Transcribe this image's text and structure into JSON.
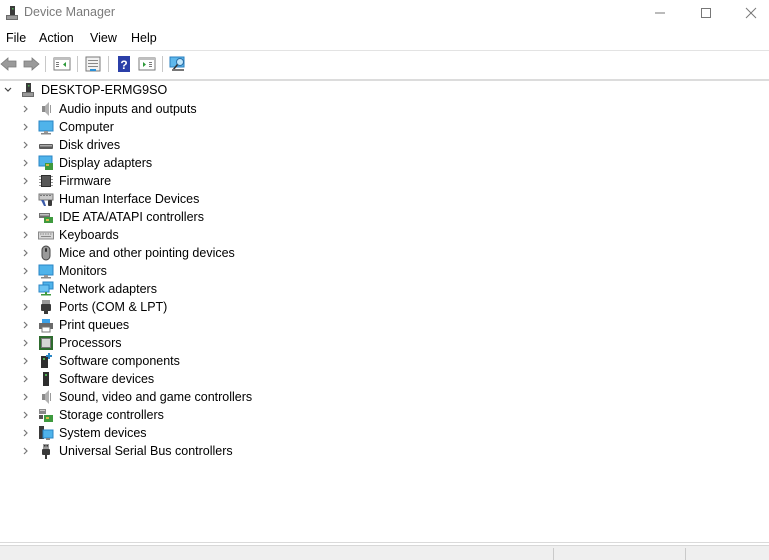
{
  "window": {
    "title": "Device Manager",
    "app_icon": "device-manager-icon",
    "controls": {
      "minimize": "—",
      "maximize": "☐",
      "close": "✕"
    }
  },
  "menubar": {
    "items": [
      {
        "label": "File"
      },
      {
        "label": "Action"
      },
      {
        "label": "View"
      },
      {
        "label": "Help"
      }
    ]
  },
  "toolbar": {
    "buttons": [
      {
        "name": "back",
        "icon": "back-arrow-icon"
      },
      {
        "name": "forward",
        "icon": "forward-arrow-icon"
      },
      {
        "name": "show-hide-console-tree",
        "icon": "console-tree-icon"
      },
      {
        "name": "properties",
        "icon": "properties-icon"
      },
      {
        "name": "help",
        "icon": "help-icon"
      },
      {
        "name": "show-hide-action-pane",
        "icon": "action-pane-icon"
      },
      {
        "name": "scan-hardware-changes",
        "icon": "scan-hardware-icon"
      }
    ]
  },
  "tree": {
    "root": {
      "label": "DESKTOP-ERMG9SO",
      "expanded": true,
      "icon": "computer-tower-icon"
    },
    "categories": [
      {
        "label": "Audio inputs and outputs",
        "icon": "speaker-icon"
      },
      {
        "label": "Computer",
        "icon": "monitor-icon"
      },
      {
        "label": "Disk drives",
        "icon": "disk-drive-icon"
      },
      {
        "label": "Display adapters",
        "icon": "display-adapter-icon"
      },
      {
        "label": "Firmware",
        "icon": "chip-icon"
      },
      {
        "label": "Human Interface Devices",
        "icon": "hid-icon"
      },
      {
        "label": "IDE ATA/ATAPI controllers",
        "icon": "ide-controller-icon"
      },
      {
        "label": "Keyboards",
        "icon": "keyboard-icon"
      },
      {
        "label": "Mice and other pointing devices",
        "icon": "mouse-icon"
      },
      {
        "label": "Monitors",
        "icon": "monitor-icon"
      },
      {
        "label": "Network adapters",
        "icon": "network-adapter-icon"
      },
      {
        "label": "Ports (COM & LPT)",
        "icon": "port-icon"
      },
      {
        "label": "Print queues",
        "icon": "printer-icon"
      },
      {
        "label": "Processors",
        "icon": "processor-icon"
      },
      {
        "label": "Software components",
        "icon": "software-component-icon"
      },
      {
        "label": "Software devices",
        "icon": "software-device-icon"
      },
      {
        "label": "Sound, video and game controllers",
        "icon": "speaker-icon"
      },
      {
        "label": "Storage controllers",
        "icon": "storage-controller-icon"
      },
      {
        "label": "System devices",
        "icon": "system-devices-icon"
      },
      {
        "label": "Universal Serial Bus controllers",
        "icon": "usb-icon"
      }
    ]
  },
  "statusbar": {
    "panes": [
      "",
      "",
      ""
    ]
  }
}
